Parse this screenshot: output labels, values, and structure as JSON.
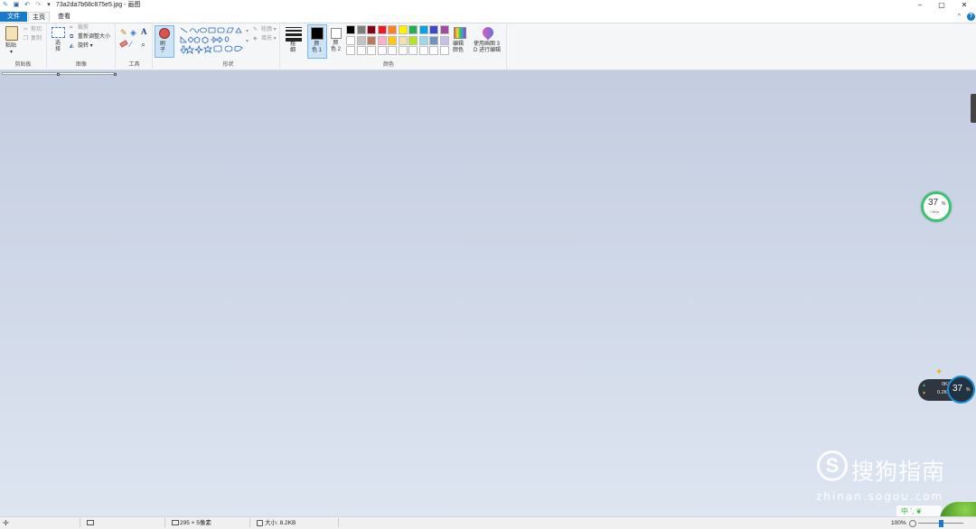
{
  "window": {
    "title": "73a2da7b68c875e5.jpg - 画图",
    "min": "–",
    "max": "▢",
    "close": "✕"
  },
  "quick_access": {
    "help_symbol": "?",
    "collapse_symbol": "⌃"
  },
  "menu": {
    "file": "文件",
    "home": "主页",
    "view": "查看"
  },
  "clipboard": {
    "paste": "粘贴",
    "cut": "剪切",
    "copy": "复制",
    "group": "剪贴板"
  },
  "image": {
    "select": "选\n择",
    "crop": "裁剪",
    "resize": "重新调整大小",
    "rotate": "旋转 ▾",
    "group": "图像"
  },
  "tools": {
    "group": "工具",
    "text_tool": "A"
  },
  "brush": {
    "label": "刷\n子"
  },
  "shapes": {
    "outline": "轮廓 ▾",
    "fill": "填充 ▾",
    "group": "形状"
  },
  "size": {
    "label": "粗\n细"
  },
  "colors": {
    "color1": "颜\n色 1",
    "color2": "颜\n色 2",
    "edit": "编辑\n颜色",
    "paint3d": "使用画图 3\nD 进行编辑",
    "group": "颜色",
    "color1_value": "#000000",
    "color2_value": "#ffffff",
    "palette_row1": [
      "#000000",
      "#7f7f7f",
      "#880015",
      "#ed1c24",
      "#ff7f27",
      "#fff200",
      "#22b14c",
      "#00a2e8",
      "#3f48cc",
      "#a349a4"
    ],
    "palette_row2": [
      "#ffffff",
      "#c3c3c3",
      "#b97a57",
      "#ffaec9",
      "#ffc90e",
      "#efe4b0",
      "#b5e61d",
      "#99d9ea",
      "#7092be",
      "#c8bfe7"
    ],
    "palette_row3": [
      "#ffffff",
      "#ffffff",
      "#ffffff",
      "#ffffff",
      "#ffffff",
      "#ffffff",
      "#ffffff",
      "#ffffff",
      "#ffffff",
      "#ffffff"
    ]
  },
  "overlay": {
    "pct1": "37",
    "unit1": "%",
    "sub1": "↑ 0K/s",
    "pct2": "37",
    "unit2": "%",
    "up": "0K/s",
    "down": "0.2K/s"
  },
  "watermark": {
    "brand": "搜狗指南",
    "url": "zhinan.sogou.com",
    "ime": "中 ʼ, ❦"
  },
  "status": {
    "dimensions": "295 × 5像素",
    "size": "大小: 8.2KB",
    "zoom": "100%"
  }
}
